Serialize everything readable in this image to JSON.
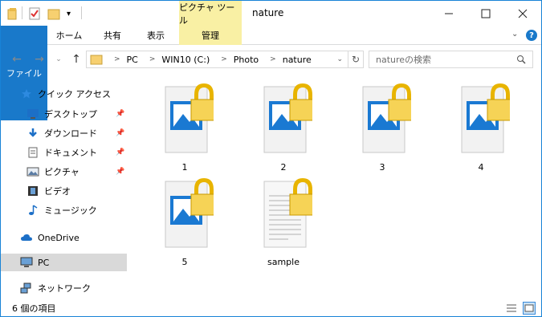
{
  "window": {
    "title": "nature",
    "context_tab_group": "ピクチャ ツール"
  },
  "ribbon": {
    "tabs": [
      "ファイル",
      "ホーム",
      "共有",
      "表示"
    ],
    "context_tab": "管理"
  },
  "address": {
    "crumbs": [
      "PC",
      "WIN10 (C:)",
      "Photo",
      "nature"
    ],
    "search_placeholder": "natureの検索"
  },
  "navpane": {
    "quick_access": "クイック アクセス",
    "items": [
      "デスクトップ",
      "ダウンロード",
      "ドキュメント",
      "ピクチャ",
      "ビデオ",
      "ミュージック"
    ],
    "onedrive": "OneDrive",
    "pc": "PC",
    "network": "ネットワーク"
  },
  "files": [
    {
      "name": "1",
      "kind": "image"
    },
    {
      "name": "2",
      "kind": "image"
    },
    {
      "name": "3",
      "kind": "image"
    },
    {
      "name": "4",
      "kind": "image"
    },
    {
      "name": "5",
      "kind": "image"
    },
    {
      "name": "sample",
      "kind": "text"
    }
  ],
  "status": {
    "count_text": "6 個の項目"
  },
  "colors": {
    "accent": "#1979ca",
    "context": "#f9f0a4",
    "selected": "#d9d9d9"
  }
}
